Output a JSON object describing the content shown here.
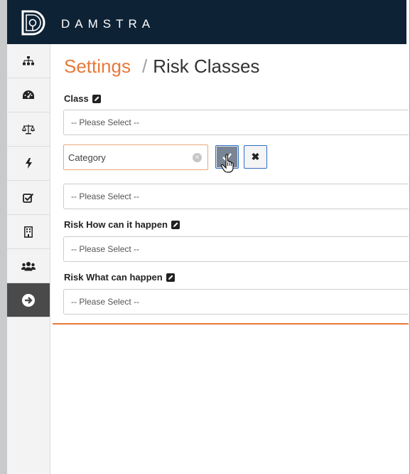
{
  "header": {
    "brand": "DAMSTRA"
  },
  "sidebar": {
    "items": [
      {
        "icon": "sitemap-icon"
      },
      {
        "icon": "dashboard-icon"
      },
      {
        "icon": "balance-scale-icon"
      },
      {
        "icon": "bolt-icon"
      },
      {
        "icon": "checkbox-icon"
      },
      {
        "icon": "building-icon"
      },
      {
        "icon": "users-icon"
      },
      {
        "icon": "arrow-right-circle-icon"
      }
    ]
  },
  "breadcrumb": {
    "parent": "Settings",
    "separator": "/",
    "current": "Risk Classes"
  },
  "form": {
    "class_label": "Class",
    "class_select": "-- Please Select --",
    "category_input": "Category",
    "clear_symbol": "×",
    "cancel_symbol": "✖",
    "sub_select": "-- Please Select --",
    "how_label": "Risk How can it happen",
    "how_select": "-- Please Select --",
    "what_label": "Risk What can happen",
    "what_select": "-- Please Select --"
  },
  "colors": {
    "topbar": "#0e2235",
    "accent": "#e8793a",
    "button_border": "#2e6fc4"
  }
}
